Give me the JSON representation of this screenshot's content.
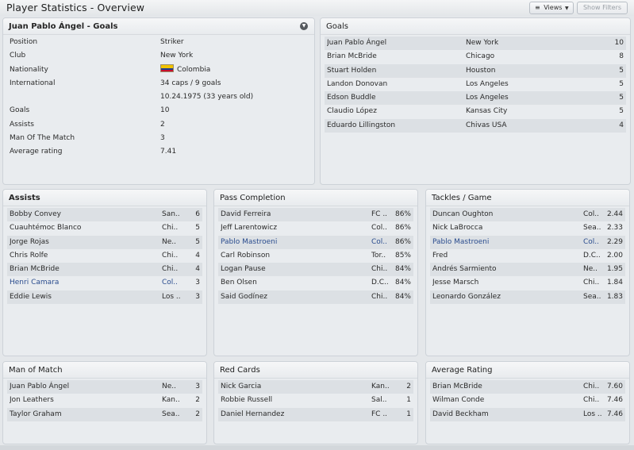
{
  "header": {
    "title": "Player Statistics - Overview",
    "views_label": "Views",
    "filters_label": "Show Filters"
  },
  "profile": {
    "title": "Juan Pablo Ángel - Goals",
    "fields": [
      {
        "label": "Position",
        "value": "Striker"
      },
      {
        "label": "Club",
        "value": "New York"
      },
      {
        "label": "Nationality",
        "value": "Colombia"
      },
      {
        "label": "International",
        "value": "34 caps / 9 goals"
      },
      {
        "label": "",
        "value": "10.24.1975 (33 years old)"
      },
      {
        "label": "Goals",
        "value": "10"
      },
      {
        "label": "Assists",
        "value": "2"
      },
      {
        "label": "Man Of The Match",
        "value": "3"
      },
      {
        "label": "Average rating",
        "value": "7.41"
      }
    ]
  },
  "goals": {
    "title": "Goals",
    "rows": [
      {
        "name": "Juan Pablo Ángel",
        "club": "New York",
        "value": "10"
      },
      {
        "name": "Brian McBride",
        "club": "Chicago",
        "value": "8"
      },
      {
        "name": "Stuart Holden",
        "club": "Houston",
        "value": "5"
      },
      {
        "name": "Landon Donovan",
        "club": "Los Angeles",
        "value": "5"
      },
      {
        "name": "Edson Buddle",
        "club": "Los Angeles",
        "value": "5"
      },
      {
        "name": "Claudio López",
        "club": "Kansas City",
        "value": "5"
      },
      {
        "name": "Eduardo Lillingston",
        "club": "Chivas USA",
        "value": "4"
      }
    ]
  },
  "assists": {
    "title": "Assists",
    "rows": [
      {
        "name": "Bobby Convey",
        "club": "San..",
        "value": "6"
      },
      {
        "name": "Cuauhtémoc Blanco",
        "club": "Chi..",
        "value": "5"
      },
      {
        "name": "Jorge Rojas",
        "club": "Ne..",
        "value": "5"
      },
      {
        "name": "Chris Rolfe",
        "club": "Chi..",
        "value": "4"
      },
      {
        "name": "Brian McBride",
        "club": "Chi..",
        "value": "4"
      },
      {
        "name": "Henri Camara",
        "club": "Col..",
        "value": "3",
        "highlight": true
      },
      {
        "name": "Eddie Lewis",
        "club": "Los ..",
        "value": "3"
      }
    ]
  },
  "pass_completion": {
    "title": "Pass Completion",
    "rows": [
      {
        "name": "David Ferreira",
        "club": "FC ..",
        "value": "86%"
      },
      {
        "name": "Jeff Larentowicz",
        "club": "Col..",
        "value": "86%"
      },
      {
        "name": "Pablo Mastroeni",
        "club": "Col..",
        "value": "86%",
        "highlight": true
      },
      {
        "name": "Carl Robinson",
        "club": "Tor..",
        "value": "85%"
      },
      {
        "name": "Logan Pause",
        "club": "Chi..",
        "value": "84%"
      },
      {
        "name": "Ben Olsen",
        "club": "D.C..",
        "value": "84%"
      },
      {
        "name": "Said Godínez",
        "club": "Chi..",
        "value": "84%"
      }
    ]
  },
  "tackles": {
    "title": "Tackles / Game",
    "rows": [
      {
        "name": "Duncan Oughton",
        "club": "Col..",
        "value": "2.44"
      },
      {
        "name": "Nick LaBrocca",
        "club": "Sea..",
        "value": "2.33"
      },
      {
        "name": "Pablo Mastroeni",
        "club": "Col..",
        "value": "2.29",
        "highlight": true
      },
      {
        "name": "Fred",
        "club": "D.C..",
        "value": "2.00"
      },
      {
        "name": "Andrés Sarmiento",
        "club": "Ne..",
        "value": "1.95"
      },
      {
        "name": "Jesse Marsch",
        "club": "Chi..",
        "value": "1.84"
      },
      {
        "name": "Leonardo González",
        "club": "Sea..",
        "value": "1.83"
      }
    ]
  },
  "man_of_match": {
    "title": "Man of Match",
    "rows": [
      {
        "name": "Juan Pablo Ángel",
        "club": "Ne..",
        "value": "3"
      },
      {
        "name": "Jon Leathers",
        "club": "Kan..",
        "value": "2"
      },
      {
        "name": "Taylor Graham",
        "club": "Sea..",
        "value": "2"
      }
    ]
  },
  "red_cards": {
    "title": "Red Cards",
    "rows": [
      {
        "name": "Nick Garcia",
        "club": "Kan..",
        "value": "2"
      },
      {
        "name": "Robbie Russell",
        "club": "Sal..",
        "value": "1"
      },
      {
        "name": "Daniel Hernandez",
        "club": "FC ..",
        "value": "1"
      }
    ]
  },
  "average_rating": {
    "title": "Average Rating",
    "rows": [
      {
        "name": "Brian McBride",
        "club": "Chi..",
        "value": "7.60"
      },
      {
        "name": "Wilman Conde",
        "club": "Chi..",
        "value": "7.46"
      },
      {
        "name": "David Beckham",
        "club": "Los ..",
        "value": "7.46"
      }
    ]
  },
  "icons": {
    "views": "list-lines-icon",
    "dropdown": "caret-down-icon",
    "panel_menu": "chevron-down-circle-icon",
    "flag": "colombia-flag-icon"
  },
  "colors": {
    "link": "#2a4c8e",
    "alt_row": "#dce0e4",
    "panel_bg": "#e9ecef"
  }
}
